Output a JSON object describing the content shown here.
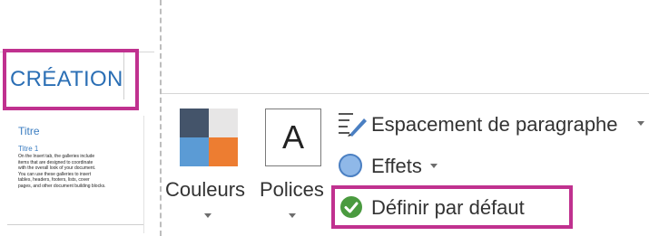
{
  "left_panel": {
    "tab_label": "CRÉATION",
    "thumbnail": {
      "title": "Titre",
      "heading1": "Titre 1",
      "body_lines": [
        "On the Insert tab, the galleries include",
        "items that are designed to coordinate",
        "with the overall look of your document.",
        "You can use these galleries to insert",
        "tables, headers, footers, lists, cover",
        "pages, and other document building blocks."
      ]
    }
  },
  "ribbon": {
    "colors": {
      "label": "Couleurs",
      "swatch": [
        "#44546a",
        "#e7e6e6",
        "#5b9bd5",
        "#ed7d31"
      ]
    },
    "fonts": {
      "label": "Polices",
      "preview_letter": "A"
    },
    "paragraph_spacing": {
      "label": "Espacement de paragraphe"
    },
    "effects": {
      "label": "Effets"
    },
    "set_default": {
      "label": "Définir par défaut"
    }
  },
  "colors": {
    "highlight": "#c0318f",
    "accent": "#2b6fb5",
    "check": "#4a9a3f"
  }
}
